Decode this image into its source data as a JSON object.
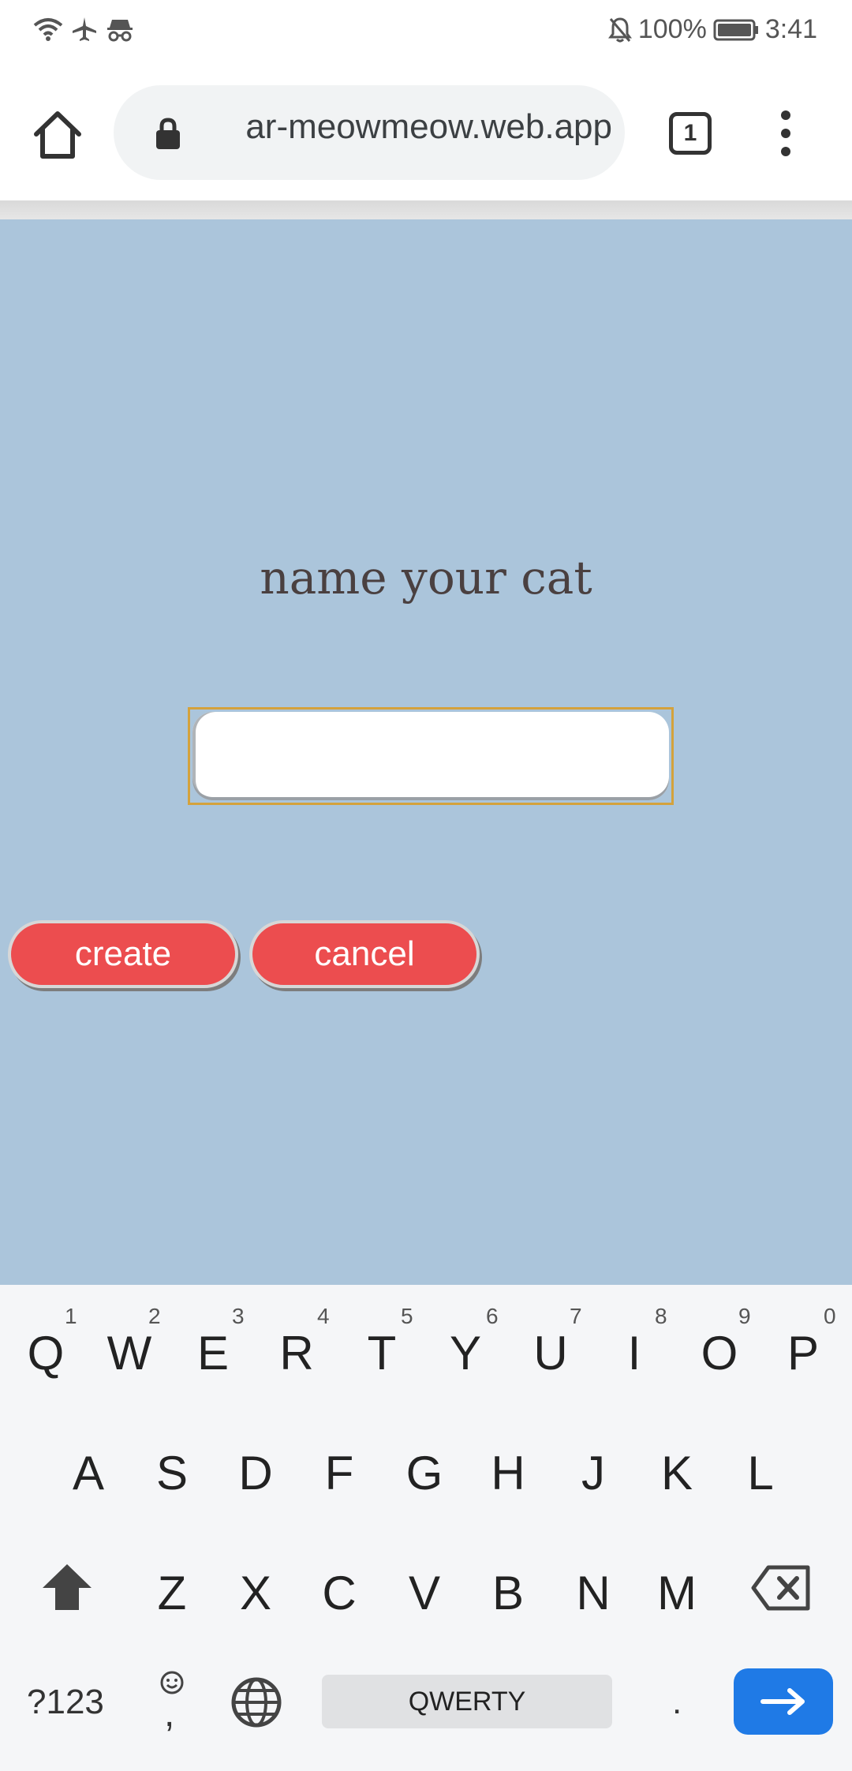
{
  "status_bar": {
    "battery": "100%",
    "time": "3:41",
    "icons": [
      "wifi-icon",
      "airplane-icon",
      "incognito-icon",
      "notifications-off-icon",
      "battery-icon"
    ]
  },
  "browser": {
    "url": "ar-meowmeow.web.app",
    "tab_count": "1",
    "icons": [
      "home-icon",
      "lock-icon",
      "tabs-icon",
      "more-menu-icon"
    ]
  },
  "page": {
    "title": "name your cat",
    "input_value": "",
    "create_label": "create",
    "cancel_label": "cancel",
    "background_color": "#abc5db",
    "button_color": "#ec4d4f"
  },
  "keyboard": {
    "row1": [
      "Q",
      "W",
      "E",
      "R",
      "T",
      "Y",
      "U",
      "I",
      "O",
      "P"
    ],
    "row1_numbers": [
      "1",
      "2",
      "3",
      "4",
      "5",
      "6",
      "7",
      "8",
      "9",
      "0"
    ],
    "row2": [
      "A",
      "S",
      "D",
      "F",
      "G",
      "H",
      "J",
      "K",
      "L"
    ],
    "row3": [
      "Z",
      "X",
      "C",
      "V",
      "B",
      "N",
      "M"
    ],
    "symbols_label": "?123",
    "comma_label": ",",
    "space_label": "QWERTY",
    "period_label": ".",
    "accent_color": "#1f7ae6"
  }
}
